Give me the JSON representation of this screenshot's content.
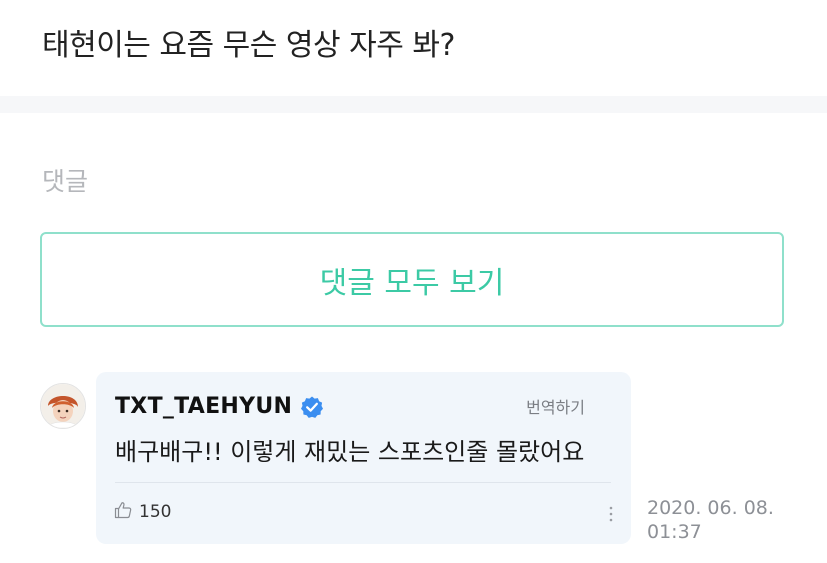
{
  "question": {
    "title": "태현이는 요즘 무슨 영상 자주 봐?"
  },
  "comments_section": {
    "label": "댓글",
    "view_all_label": "댓글 모두 보기"
  },
  "comment": {
    "author": "TXT_TAEHYUN",
    "verified_icon": "verified-badge-icon",
    "translate_label": "번역하기",
    "text": "배구배구!! 이렇게 재밌는 스포츠인줄 몰랐어요",
    "like_icon": "thumbs-up-icon",
    "likes": "150",
    "more_icon": "more-vertical-icon",
    "date_line1": "2020. 06. 08.",
    "date_line2": "01:37"
  },
  "colors": {
    "accent": "#3ccaa5",
    "accent_border": "#8fe0cb",
    "verified": "#3b8ef0",
    "card_bg": "#f1f6fb"
  }
}
